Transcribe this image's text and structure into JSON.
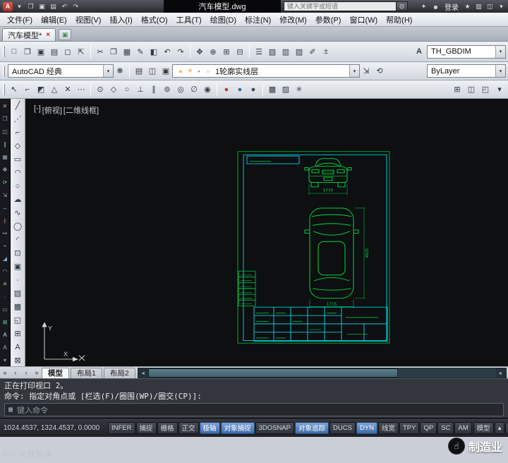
{
  "window": {
    "title": "汽车模型.dwg",
    "search_placeholder": "键入关键字或短语",
    "login": "登录"
  },
  "icons": {
    "logo": "A",
    "search": "⊙",
    "comm": "✦",
    "user": "☻",
    "close": "×",
    "tabnew": "▣",
    "down": "▾",
    "textstyle": "A",
    "left": "◂",
    "right": "▸",
    "keyboard": "▦",
    "hand": "☝"
  },
  "titlebar": {
    "qat": [
      {
        "n": "qat-dropdown-icon",
        "g": "▾"
      },
      {
        "n": "open-icon",
        "g": "❒"
      },
      {
        "n": "save-icon",
        "g": "▣"
      },
      {
        "n": "plot-icon",
        "g": "▤"
      },
      {
        "n": "undo-icon",
        "g": "↶"
      },
      {
        "n": "redo-icon",
        "g": "↷"
      }
    ],
    "right": [
      {
        "n": "favorites-icon",
        "g": "★"
      },
      {
        "n": "exchange-icon",
        "g": "▥"
      },
      {
        "n": "panel-icon",
        "g": "◫"
      },
      {
        "n": "titlebar-options-icon",
        "g": "▾"
      }
    ]
  },
  "menu": {
    "items": [
      {
        "n": "menu-file",
        "t": "文件(F)"
      },
      {
        "n": "menu-edit",
        "t": "编辑(E)"
      },
      {
        "n": "menu-view",
        "t": "视图(V)"
      },
      {
        "n": "menu-insert",
        "t": "插入(I)"
      },
      {
        "n": "menu-format",
        "t": "格式(O)"
      },
      {
        "n": "menu-tools",
        "t": "工具(T)"
      },
      {
        "n": "menu-draw",
        "t": "绘图(D)"
      },
      {
        "n": "menu-dimension",
        "t": "标注(N)"
      },
      {
        "n": "menu-modify",
        "t": "修改(M)"
      },
      {
        "n": "menu-parametric",
        "t": "参数(P)"
      },
      {
        "n": "menu-window",
        "t": "窗口(W)"
      },
      {
        "n": "menu-help",
        "t": "帮助(H)"
      }
    ]
  },
  "filetab": {
    "label": "汽车模型*"
  },
  "toolbar_main": {
    "dim_style": "TH_GBDIM",
    "left": [
      {
        "n": "qnew-button",
        "g": "□"
      },
      {
        "n": "open-button",
        "g": "❒"
      },
      {
        "n": "save-button",
        "g": "▣"
      },
      {
        "n": "plot-button",
        "g": "▤"
      },
      {
        "n": "plot-preview-button",
        "g": "◻"
      },
      {
        "n": "publish-button",
        "g": "⇱"
      },
      {
        "sep": true
      },
      {
        "n": "cut-button",
        "g": "✂"
      },
      {
        "n": "copy-button",
        "g": "❐"
      },
      {
        "n": "paste-button",
        "g": "▦"
      },
      {
        "n": "match-properties-button",
        "g": "✎"
      },
      {
        "n": "block-editor-button",
        "g": "◧"
      },
      {
        "n": "undo-button",
        "g": "↶"
      },
      {
        "n": "redo-button",
        "g": "↷"
      },
      {
        "sep": true
      },
      {
        "n": "pan-button",
        "g": "✥"
      },
      {
        "n": "zoom-realtime-button",
        "g": "⊕"
      },
      {
        "n": "zoom-window-button",
        "g": "⊞"
      },
      {
        "n": "zoom-previous-button",
        "g": "⊟"
      },
      {
        "sep": true
      },
      {
        "n": "properties-button",
        "g": "☰"
      },
      {
        "n": "designcenter-button",
        "g": "▧"
      },
      {
        "n": "tool-palettes-button",
        "g": "▥"
      },
      {
        "n": "sheet-set-button",
        "g": "▨"
      },
      {
        "n": "markup-button",
        "g": "✐"
      },
      {
        "n": "quickcalc-button",
        "g": "±"
      }
    ]
  },
  "toolbar_layers": {
    "workspace": "AutoCAD 经典",
    "layer": "1轮廓实线层",
    "color": "ByLayer",
    "pre": [
      {
        "n": "workspace-settings-icon",
        "g": "❋"
      },
      {
        "sep": true
      },
      {
        "n": "layer-properties-button",
        "g": "▤"
      },
      {
        "n": "layer-states-button",
        "g": "◫"
      },
      {
        "n": "layer-isolate-button",
        "g": "▣"
      }
    ],
    "layer_icons": [
      {
        "n": "layer-on-icon",
        "g": "●",
        "c": "#f2c41d",
        "i": false
      },
      {
        "n": "layer-thaw-icon",
        "g": "☀",
        "c": "#f59a23",
        "i": false
      },
      {
        "n": "layer-lock-icon",
        "g": "▪",
        "c": "#8a929b",
        "i": false
      },
      {
        "n": "layer-color-icon",
        "g": "■",
        "c": "#e8e8e8",
        "i": false
      }
    ],
    "post": [
      {
        "n": "make-object-layer-current-button",
        "g": "⇲"
      },
      {
        "n": "layer-previous-button",
        "g": "⟲"
      }
    ]
  },
  "toolbar_osnap": {
    "left": [
      {
        "n": "snap-temporary-track-button",
        "g": "↖"
      },
      {
        "n": "snap-from-button",
        "g": "⌐"
      },
      {
        "n": "snap-endpoint-button",
        "g": "◩"
      },
      {
        "n": "snap-midpoint-button",
        "g": "△"
      },
      {
        "n": "snap-intersection-button",
        "g": "✕"
      },
      {
        "n": "snap-extension-button",
        "g": "⋯"
      },
      {
        "sep": true
      },
      {
        "n": "snap-center-button",
        "g": "⊙"
      },
      {
        "n": "snap-quadrant-button",
        "g": "◇"
      },
      {
        "n": "snap-tangent-button",
        "g": "○"
      },
      {
        "n": "snap-perpendicular-button",
        "g": "⊥"
      },
      {
        "n": "snap-parallel-button",
        "g": "∥"
      },
      {
        "n": "snap-node-button",
        "g": "⊚"
      },
      {
        "n": "snap-nearest-button",
        "g": "◎"
      },
      {
        "n": "snap-none-button",
        "g": "∅"
      },
      {
        "n": "osnap-settings-button",
        "g": "◉"
      },
      {
        "sep": true
      },
      {
        "n": "shade-ball-red-icon",
        "g": "●",
        "c": "#c03a32"
      },
      {
        "n": "shade-ball-blue-icon",
        "g": "●",
        "c": "#3a62b0"
      },
      {
        "n": "shade-ball-dark-icon",
        "g": "●",
        "c": "#3d4450"
      },
      {
        "sep": true
      },
      {
        "n": "render-button",
        "g": "▩"
      },
      {
        "n": "materials-button",
        "g": "▨"
      },
      {
        "n": "lights-button",
        "g": "✳"
      }
    ],
    "right": [
      {
        "n": "viewport-config-button",
        "g": "⊞"
      },
      {
        "n": "named-views-button",
        "g": "◫"
      },
      {
        "n": "3d-views-button",
        "g": "◰"
      },
      {
        "n": "toolbar-overflow-icon",
        "g": "▾"
      }
    ]
  },
  "left_strip": {
    "items": [
      {
        "n": "erase-tool",
        "g": "✕",
        "c": "#a7b6bc"
      },
      {
        "n": "copy-tool",
        "g": "❐",
        "c": "#8fa7ad"
      },
      {
        "n": "mirror-tool",
        "g": "◫",
        "c": "#8fa7ad"
      },
      {
        "n": "offset-tool",
        "g": "∥",
        "c": "#74c79b"
      },
      {
        "n": "array-tool",
        "g": "▦",
        "c": "#8fa7ad"
      },
      {
        "n": "move-tool",
        "g": "✥",
        "c": "#a7b6bc"
      },
      {
        "n": "rotate-tool",
        "g": "⟳",
        "c": "#74c79b"
      },
      {
        "n": "scale-tool",
        "g": "⇲",
        "c": "#8fa7ad"
      },
      {
        "n": "stretch-tool",
        "g": "↔",
        "c": "#8fa7ad"
      },
      {
        "n": "trim-tool",
        "g": "∤",
        "c": "#c98a80"
      },
      {
        "n": "extend-tool",
        "g": "↦",
        "c": "#8fa7ad"
      },
      {
        "n": "break-tool",
        "g": "⌁",
        "c": "#8fa7ad"
      },
      {
        "n": "chamfer-tool",
        "g": "◢",
        "c": "#74a8c7"
      },
      {
        "n": "fillet-tool",
        "g": "◠",
        "c": "#74a8c7"
      },
      {
        "n": "explode-tool",
        "g": "✳",
        "c": "#c9b274"
      },
      {
        "n": "join-tool",
        "g": "∙",
        "c": "#8fa7ad"
      },
      {
        "n": "rect-strip-tool",
        "g": "▭",
        "c": "#8fa7ad"
      },
      {
        "n": "grid-strip-tool",
        "g": "⊞",
        "c": "#74c79b"
      },
      {
        "n": "text-tool-a",
        "g": "A",
        "c": "#d8dde0"
      },
      {
        "n": "text-tool-b",
        "g": "A",
        "c": "#9fb4bb"
      },
      {
        "n": "strip-more-icon",
        "g": "▾",
        "c": "#8fa7ad"
      }
    ]
  },
  "left_toolbar": {
    "items": [
      {
        "n": "line-tool",
        "g": "╱"
      },
      {
        "n": "construction-line-tool",
        "g": "⋰"
      },
      {
        "n": "polyline-tool",
        "g": "⌐"
      },
      {
        "n": "polygon-tool",
        "g": "◇"
      },
      {
        "n": "rectangle-tool",
        "g": "▭"
      },
      {
        "n": "arc-tool",
        "g": "◠"
      },
      {
        "n": "circle-tool",
        "g": "○"
      },
      {
        "n": "revcloud-tool",
        "g": "☁"
      },
      {
        "n": "spline-tool",
        "g": "∿"
      },
      {
        "n": "ellipse-tool",
        "g": "◯"
      },
      {
        "n": "ellipse-arc-tool",
        "g": "◜"
      },
      {
        "n": "insert-block-tool",
        "g": "⊡"
      },
      {
        "n": "make-block-tool",
        "g": "▣"
      },
      {
        "n": "point-tool",
        "g": "∙"
      },
      {
        "n": "hatch-tool",
        "g": "▨"
      },
      {
        "n": "gradient-tool",
        "g": "▩"
      },
      {
        "n": "region-tool",
        "g": "◱"
      },
      {
        "n": "table-tool",
        "g": "⊞"
      },
      {
        "n": "mtext-tool",
        "g": "A"
      },
      {
        "n": "block-tool",
        "g": "⊠"
      }
    ]
  },
  "canvas": {
    "vp_controls": "[-]",
    "vp_view": "[俯视]",
    "vp_style": "[二维线框]"
  },
  "drawing": {
    "front_width": "1715",
    "overall_length": "4925",
    "top_width": "1715",
    "ucs_x": "X",
    "ucs_y": "Y"
  },
  "layout_tabs": {
    "nav": [
      {
        "n": "tab-first-button",
        "g": "«"
      },
      {
        "n": "tab-prev-button",
        "g": "‹"
      },
      {
        "n": "tab-next-button",
        "g": "›"
      },
      {
        "n": "tab-last-button",
        "g": "»"
      }
    ],
    "tabs": [
      {
        "n": "tab-model",
        "t": "模型",
        "active": true
      },
      {
        "n": "tab-layout1",
        "t": "布局1"
      },
      {
        "n": "tab-layout2",
        "t": "布局2"
      }
    ]
  },
  "command": {
    "line1": "正在打印视口 2。",
    "line2": "命令: 指定对角点或 [栏选(F)/圈围(WP)/圈交(CP)]:",
    "prompt_placeholder": "键入命令"
  },
  "statusbar": {
    "coords": "1024.4537, 1324.4537, 0.0000",
    "buttons": [
      {
        "n": "infer-toggle",
        "t": "INFER"
      },
      {
        "n": "snap-toggle",
        "t": "捕捉"
      },
      {
        "n": "grid-toggle",
        "t": "栅格"
      },
      {
        "n": "ortho-toggle",
        "t": "正交"
      },
      {
        "n": "polar-toggle",
        "t": "极轴",
        "active": true
      },
      {
        "n": "osnap-toggle",
        "t": "对象捕捉",
        "active": true
      },
      {
        "n": "3dosnap-toggle",
        "t": "3DOSNAP"
      },
      {
        "n": "otrack-toggle",
        "t": "对象追踪",
        "active": true
      },
      {
        "n": "ducs-toggle",
        "t": "DUCS"
      },
      {
        "n": "dyn-toggle",
        "t": "DYN",
        "active": true
      },
      {
        "n": "lwt-toggle",
        "t": "线宽"
      },
      {
        "n": "tpy-toggle",
        "t": "TPY"
      },
      {
        "n": "qp-toggle",
        "t": "QP"
      },
      {
        "n": "sc-toggle",
        "t": "SC"
      },
      {
        "n": "am-toggle",
        "t": "AM"
      }
    ],
    "right": [
      {
        "n": "model-space-button",
        "t": "模型"
      },
      {
        "n": "annotation-scale-icon",
        "g": "▴"
      },
      {
        "n": "status-menu-icon",
        "g": "▾"
      }
    ]
  },
  "watermarks": {
    "left": "CO 天数驾境",
    "right": "制造业"
  }
}
